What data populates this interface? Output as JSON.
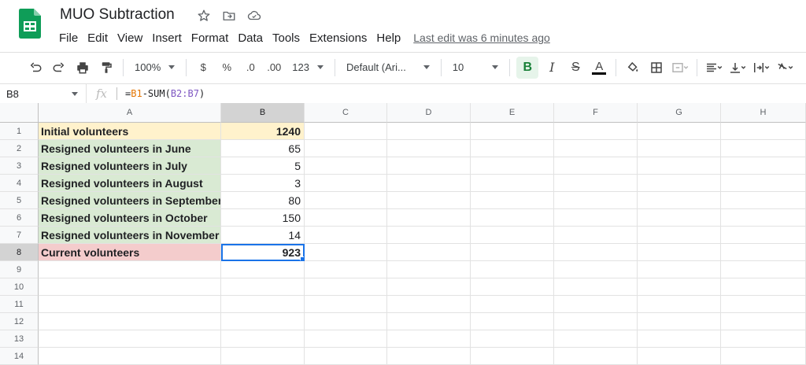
{
  "doc": {
    "title": "MUO Subtraction"
  },
  "menu": [
    "File",
    "Edit",
    "View",
    "Insert",
    "Format",
    "Data",
    "Tools",
    "Extensions",
    "Help"
  ],
  "last_edit": "Last edit was 6 minutes ago",
  "toolbar": {
    "zoom": "100%",
    "currency": "$",
    "percent": "%",
    "dec_decrease": ".0",
    "dec_increase": ".00",
    "more_formats": "123",
    "font": "Default (Ari...",
    "font_size": "10",
    "bold": "B",
    "italic": "I",
    "strike": "S",
    "text_color": "A"
  },
  "formula_bar": {
    "cell_ref": "B8",
    "fx": "fx",
    "formula_prefix": "=",
    "formula_ref1": "B1",
    "formula_mid": "-SUM(",
    "formula_ref2": "B2:B7",
    "formula_suffix": ")"
  },
  "columns": [
    "A",
    "B",
    "C",
    "D",
    "E",
    "F",
    "G",
    "H"
  ],
  "rows": [
    {
      "num": "1",
      "a": "Initial volunteers",
      "b": "1240"
    },
    {
      "num": "2",
      "a": "Resigned volunteers in June",
      "b": "65"
    },
    {
      "num": "3",
      "a": "Resigned volunteers in July",
      "b": "5"
    },
    {
      "num": "4",
      "a": "Resigned volunteers in August",
      "b": "3"
    },
    {
      "num": "5",
      "a": "Resigned volunteers in September",
      "b": "80"
    },
    {
      "num": "6",
      "a": "Resigned volunteers in October",
      "b": "150"
    },
    {
      "num": "7",
      "a": "Resigned volunteers in November",
      "b": "14"
    },
    {
      "num": "8",
      "a": "Current volunteers",
      "b": "923"
    },
    {
      "num": "9",
      "a": "",
      "b": ""
    },
    {
      "num": "10",
      "a": "",
      "b": ""
    },
    {
      "num": "11",
      "a": "",
      "b": ""
    },
    {
      "num": "12",
      "a": "",
      "b": ""
    },
    {
      "num": "13",
      "a": "",
      "b": ""
    },
    {
      "num": "14",
      "a": "",
      "b": ""
    }
  ],
  "colors": {
    "yellow_fill": "#fff2cc",
    "green_fill": "#d9ead3",
    "red_fill": "#f4cccc",
    "selection": "#1a73e8",
    "sheets_green": "#0f9d58"
  }
}
